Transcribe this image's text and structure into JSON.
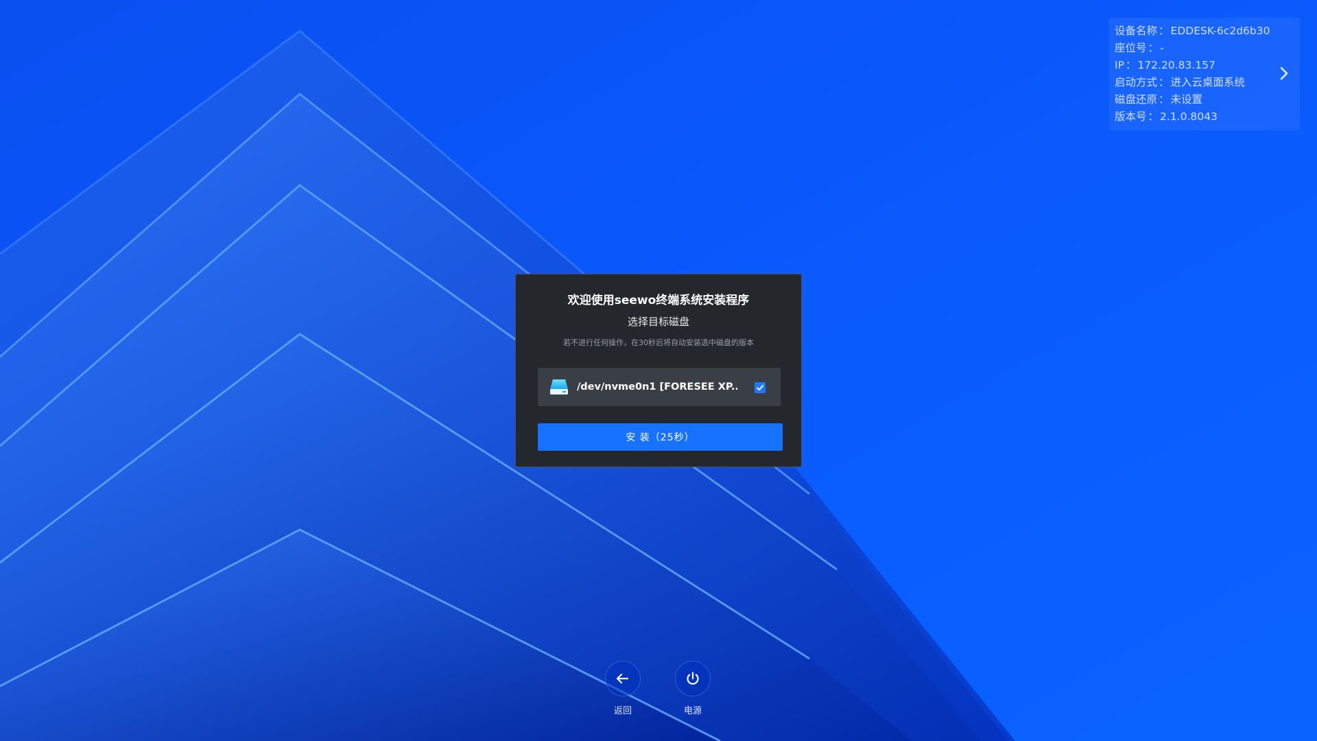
{
  "info_panel": {
    "device_name_label": "设备名称",
    "device_name_value": "EDDESK-6c2d6b30",
    "seat_label": "座位号",
    "seat_value": "-",
    "ip_label": "IP",
    "ip_value": "172.20.83.157",
    "boot_mode_label": "启动方式",
    "boot_mode_value": "进入云桌面系统",
    "disk_restore_label": "磁盘还原",
    "disk_restore_value": "未设置",
    "version_label": "版本号",
    "version_value": "2.1.0.8043",
    "separator": "：",
    "toggle_icon": "chevron-right-icon"
  },
  "dialog": {
    "title": "欢迎使用seewo终端系统安装程序",
    "subtitle": "选择目标磁盘",
    "hint": "若不进行任何操作，在30秒后将自动安装选中磁盘的版本",
    "disk": {
      "label": "/dev/nvme0n1 [FORESEE XP...",
      "icon": "disk-drive-icon",
      "checked": true
    },
    "install_button_label": "安 装（25秒）"
  },
  "bottom_controls": {
    "back_label": "返回",
    "back_icon": "arrow-left-icon",
    "power_label": "电源",
    "power_icon": "power-icon"
  },
  "colors": {
    "accent": "#1672ff",
    "dialog_bg": "#24272c",
    "desktop_bg": "#0b5cff"
  }
}
